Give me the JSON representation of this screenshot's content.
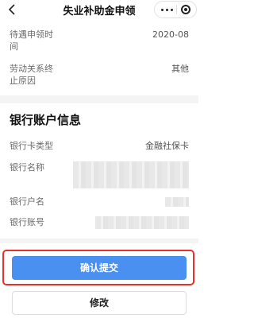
{
  "header": {
    "title": "失业补助金申领"
  },
  "fields": {
    "treatment_month": {
      "label_line1": "待遇申领时",
      "label_line2": "间",
      "value": "2020-08"
    },
    "termination_reason": {
      "label_line1": "劳动关系终",
      "label_line2": "止原因",
      "value": "其他"
    }
  },
  "bank": {
    "section_title": "银行账户信息",
    "card_type": {
      "label": "银行卡类型",
      "value": "金融社保卡"
    },
    "bank_name": {
      "label": "银行名称"
    },
    "account_name": {
      "label": "银行户名"
    },
    "account_number": {
      "label": "银行账号"
    }
  },
  "actions": {
    "confirm_label": "确认提交",
    "edit_label": "修改"
  },
  "colors": {
    "primary": "#4a90f0",
    "highlight": "#e8302c"
  }
}
